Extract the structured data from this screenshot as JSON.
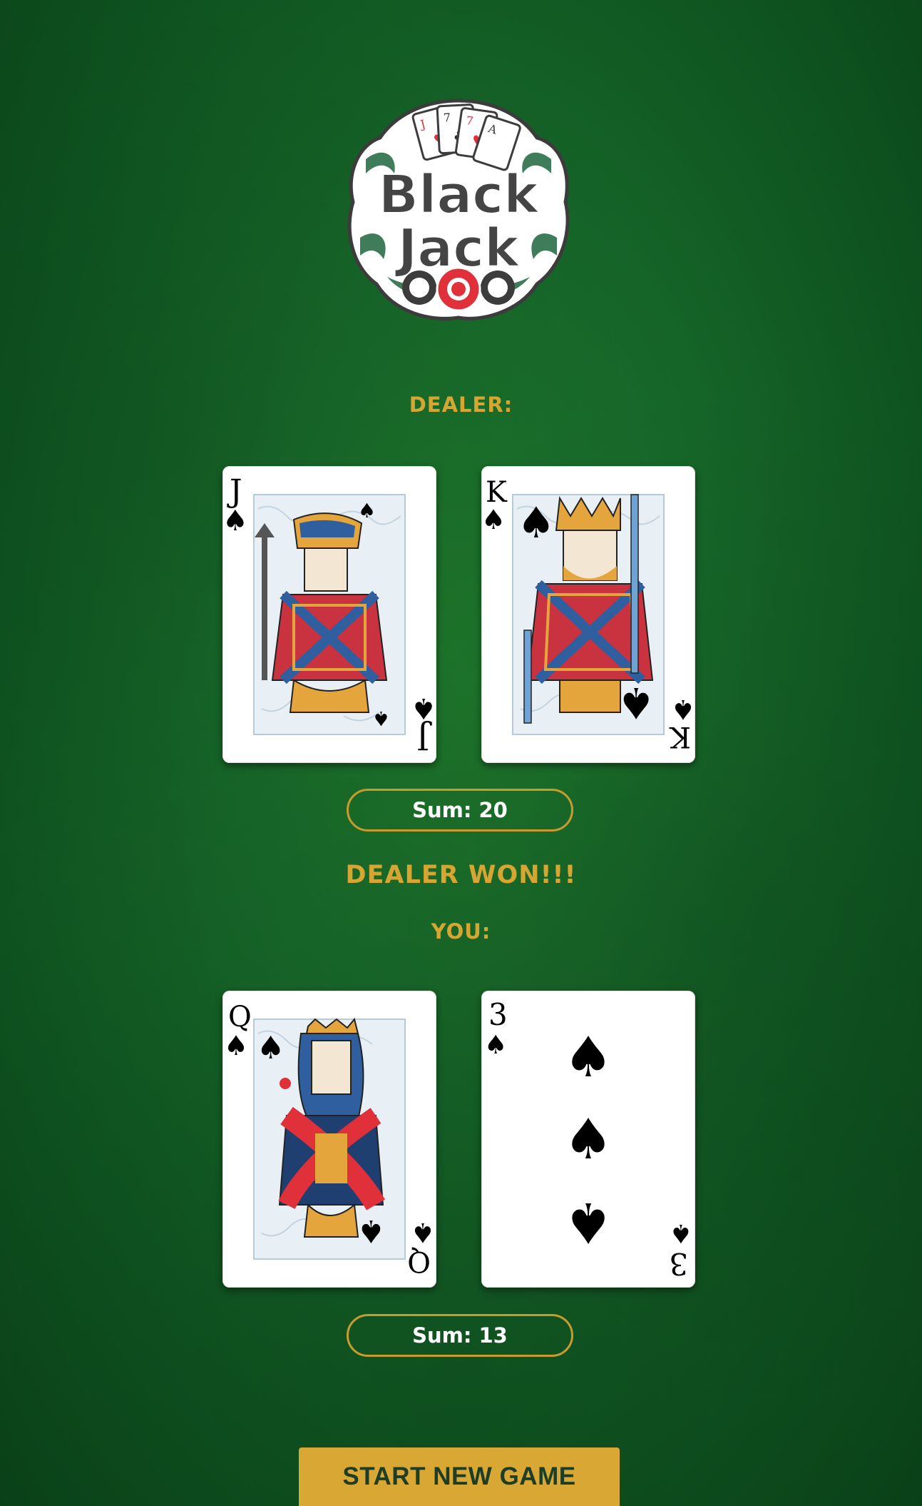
{
  "logo": {
    "line1": "Black",
    "line2": "Jack",
    "card_glyphs": [
      "J",
      "7",
      "7",
      "A"
    ]
  },
  "dealer": {
    "label": "DEALER:",
    "cards": [
      {
        "rank": "J",
        "suit": "spades"
      },
      {
        "rank": "K",
        "suit": "spades"
      }
    ],
    "sum_label": "Sum:",
    "sum_value": "20"
  },
  "result": "DEALER WON!!!",
  "player": {
    "label": "YOU:",
    "cards": [
      {
        "rank": "Q",
        "suit": "spades"
      },
      {
        "rank": "3",
        "suit": "spades"
      }
    ],
    "sum_label": "Sum:",
    "sum_value": "13"
  },
  "actions": {
    "start_new_game": "START NEW GAME"
  },
  "colors": {
    "felt": "#17692a",
    "gold": "#d7a531",
    "button": "#d9a733"
  }
}
